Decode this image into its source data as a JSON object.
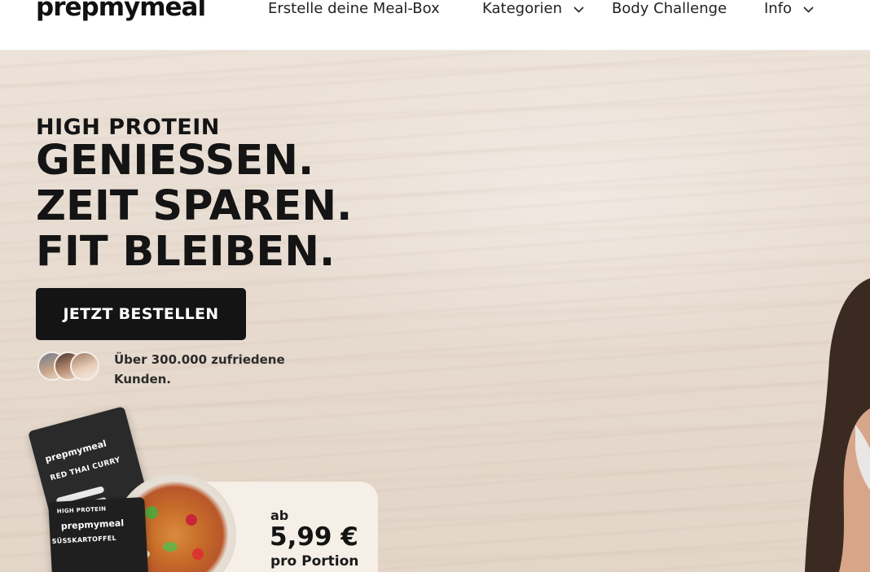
{
  "brand": {
    "logo_text": "prepmymeal"
  },
  "nav": {
    "items": [
      {
        "label": "Erstelle deine Meal-Box",
        "has_dropdown": false
      },
      {
        "label": "Kategorien",
        "has_dropdown": true
      },
      {
        "label": "Body Challenge",
        "has_dropdown": false
      },
      {
        "label": "Info",
        "has_dropdown": true
      }
    ]
  },
  "hero": {
    "kicker": "HIGH PROTEIN",
    "lines": [
      "GENIESSEN.",
      "ZEIT SPAREN.",
      "FIT BLEIBEN."
    ],
    "cta_label": "JETZT BESTELLEN",
    "social_proof": "Über 300.000 zufriedene Kunden."
  },
  "product": {
    "pack1_brand": "prepmymeal",
    "pack1_name": "RED THAI CURRY",
    "pack2_brand": "prepmymeal",
    "pack2_name": "SÜSSKARTOFFEL",
    "pack2_tag": "HIGH PROTEIN",
    "price_prefix": "ab",
    "price_value": "5,99 €",
    "price_unit": "pro Portion"
  },
  "colors": {
    "text_dark": "#141414",
    "cta_bg": "#141414",
    "cta_text": "#ffffff",
    "hero_bg": "#e8ddd2"
  }
}
